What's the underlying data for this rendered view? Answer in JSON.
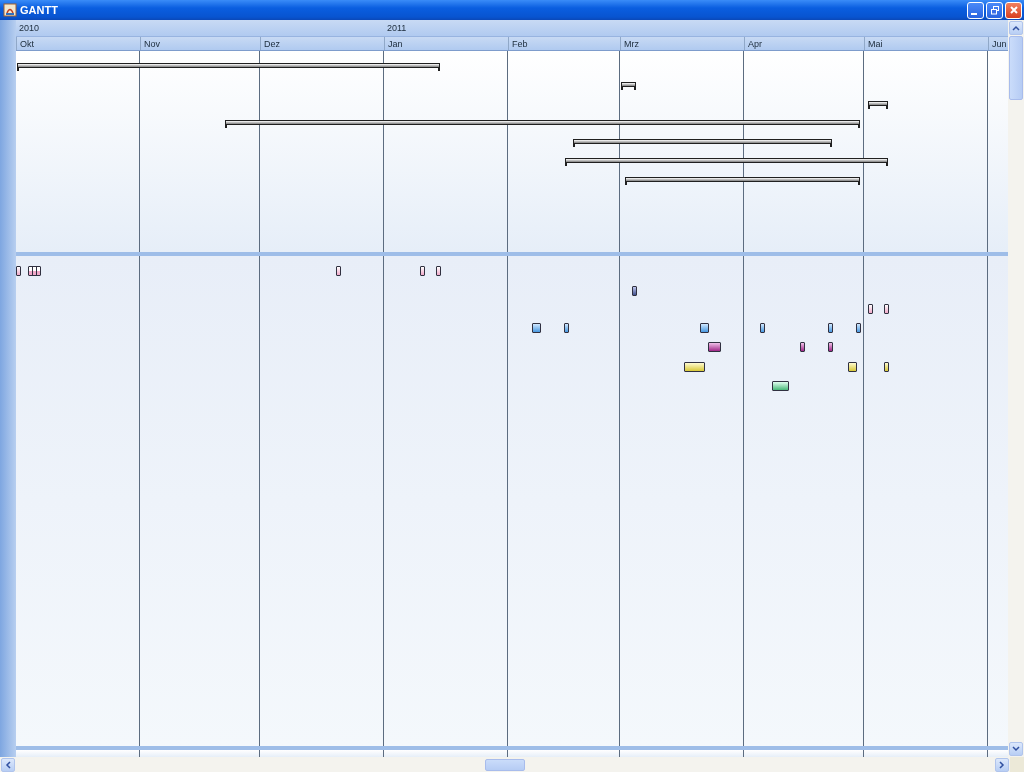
{
  "window": {
    "title": "GANTT"
  },
  "timeline": {
    "years": [
      {
        "label": "2010",
        "months": [
          "Okt",
          "Nov",
          "Dez"
        ]
      },
      {
        "label": "2011",
        "months": [
          "Jan",
          "Feb",
          "Mrz",
          "Apr",
          "Mai",
          "Jun"
        ]
      }
    ]
  }
}
